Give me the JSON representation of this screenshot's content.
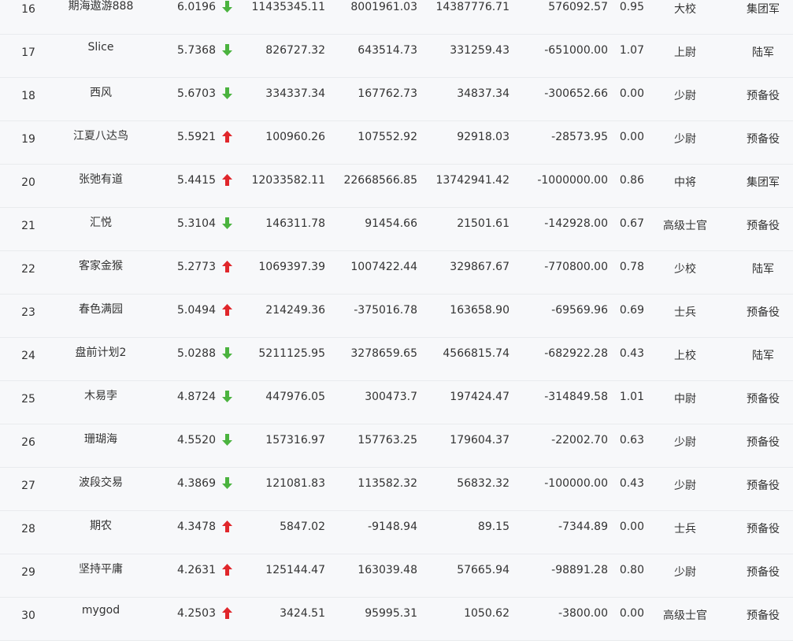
{
  "rows": [
    {
      "rank": "16",
      "name": "期海遨游888",
      "score": "6.0196",
      "trend": "down",
      "v1": "11435345.11",
      "v2": "8001961.03",
      "v3": "14387776.71",
      "v4": "576092.57",
      "ratio": "0.95",
      "title": "大校",
      "group": "集团军"
    },
    {
      "rank": "17",
      "name": "Slice",
      "score": "5.7368",
      "trend": "down",
      "v1": "826727.32",
      "v2": "643514.73",
      "v3": "331259.43",
      "v4": "-651000.00",
      "ratio": "1.07",
      "title": "上尉",
      "group": "陆军"
    },
    {
      "rank": "18",
      "name": "西风",
      "score": "5.6703",
      "trend": "down",
      "v1": "334337.34",
      "v2": "167762.73",
      "v3": "34837.34",
      "v4": "-300652.66",
      "ratio": "0.00",
      "title": "少尉",
      "group": "预备役"
    },
    {
      "rank": "19",
      "name": "江夏八达鸟",
      "score": "5.5921",
      "trend": "up",
      "v1": "100960.26",
      "v2": "107552.92",
      "v3": "92918.03",
      "v4": "-28573.95",
      "ratio": "0.00",
      "title": "少尉",
      "group": "预备役"
    },
    {
      "rank": "20",
      "name": "张弛有道",
      "score": "5.4415",
      "trend": "up",
      "v1": "12033582.11",
      "v2": "22668566.85",
      "v3": "13742941.42",
      "v4": "-1000000.00",
      "ratio": "0.86",
      "title": "中将",
      "group": "集团军"
    },
    {
      "rank": "21",
      "name": "汇悦",
      "score": "5.3104",
      "trend": "down",
      "v1": "146311.78",
      "v2": "91454.66",
      "v3": "21501.61",
      "v4": "-142928.00",
      "ratio": "0.67",
      "title": "高级士官",
      "group": "预备役"
    },
    {
      "rank": "22",
      "name": "客家金猴",
      "score": "5.2773",
      "trend": "up",
      "v1": "1069397.39",
      "v2": "1007422.44",
      "v3": "329867.67",
      "v4": "-770800.00",
      "ratio": "0.78",
      "title": "少校",
      "group": "陆军"
    },
    {
      "rank": "23",
      "name": "春色满园",
      "score": "5.0494",
      "trend": "up",
      "v1": "214249.36",
      "v2": "-375016.78",
      "v3": "163658.90",
      "v4": "-69569.96",
      "ratio": "0.69",
      "title": "士兵",
      "group": "预备役"
    },
    {
      "rank": "24",
      "name": "盘前计划2",
      "score": "5.0288",
      "trend": "down",
      "v1": "5211125.95",
      "v2": "3278659.65",
      "v3": "4566815.74",
      "v4": "-682922.28",
      "ratio": "0.43",
      "title": "上校",
      "group": "陆军"
    },
    {
      "rank": "25",
      "name": "木易孛",
      "score": "4.8724",
      "trend": "down",
      "v1": "447976.05",
      "v2": "300473.7",
      "v3": "197424.47",
      "v4": "-314849.58",
      "ratio": "1.01",
      "title": "中尉",
      "group": "预备役"
    },
    {
      "rank": "26",
      "name": "珊瑚海",
      "score": "4.5520",
      "trend": "down",
      "v1": "157316.97",
      "v2": "157763.25",
      "v3": "179604.37",
      "v4": "-22002.70",
      "ratio": "0.63",
      "title": "少尉",
      "group": "预备役"
    },
    {
      "rank": "27",
      "name": "波段交易",
      "score": "4.3869",
      "trend": "down",
      "v1": "121081.83",
      "v2": "113582.32",
      "v3": "56832.32",
      "v4": "-100000.00",
      "ratio": "0.43",
      "title": "少尉",
      "group": "预备役"
    },
    {
      "rank": "28",
      "name": "期农",
      "score": "4.3478",
      "trend": "up",
      "v1": "5847.02",
      "v2": "-9148.94",
      "v3": "89.15",
      "v4": "-7344.89",
      "ratio": "0.00",
      "title": "士兵",
      "group": "预备役"
    },
    {
      "rank": "29",
      "name": "坚持平庸",
      "score": "4.2631",
      "trend": "up",
      "v1": "125144.47",
      "v2": "163039.48",
      "v3": "57665.94",
      "v4": "-98891.28",
      "ratio": "0.80",
      "title": "少尉",
      "group": "预备役"
    },
    {
      "rank": "30",
      "name": "mygod",
      "score": "4.2503",
      "trend": "up",
      "v1": "3424.51",
      "v2": "95995.31",
      "v3": "1050.62",
      "v4": "-3800.00",
      "ratio": "0.00",
      "title": "高级士官",
      "group": "预备役"
    }
  ],
  "colors": {
    "up": "#e0262b",
    "down": "#4bb33f"
  }
}
